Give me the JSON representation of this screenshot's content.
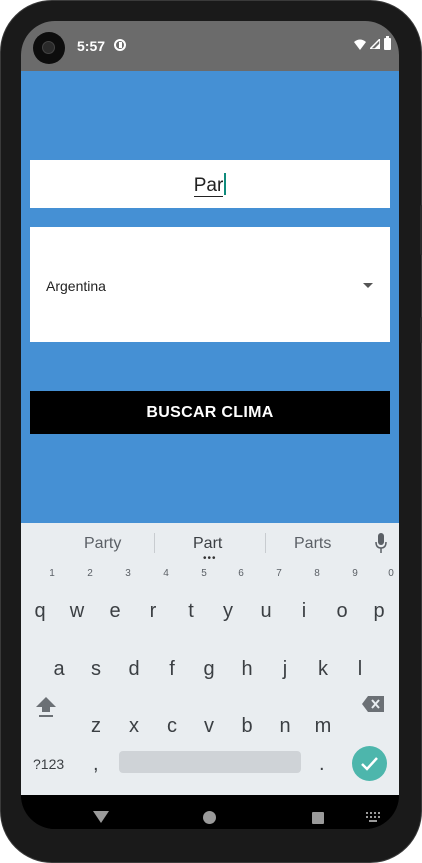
{
  "status_bar": {
    "time": "5:57",
    "icons": [
      "dnd-icon",
      "wifi-icon",
      "signal-icon",
      "battery-icon"
    ]
  },
  "app": {
    "background_color": "#4590d4",
    "city_input": {
      "value": "Par"
    },
    "country_select": {
      "selected": "Argentina"
    },
    "search_button": {
      "label": "BUSCAR CLIMA"
    }
  },
  "keyboard": {
    "suggestions": [
      "Party",
      "Part",
      "Parts"
    ],
    "row1": [
      "q",
      "w",
      "e",
      "r",
      "t",
      "y",
      "u",
      "i",
      "o",
      "p"
    ],
    "row1_hints": [
      "1",
      "2",
      "3",
      "4",
      "5",
      "6",
      "7",
      "8",
      "9",
      "0"
    ],
    "row2": [
      "a",
      "s",
      "d",
      "f",
      "g",
      "h",
      "j",
      "k",
      "l"
    ],
    "row3": [
      "z",
      "x",
      "c",
      "v",
      "b",
      "n",
      "m"
    ],
    "symbols_label": "?123",
    "comma": ",",
    "period": ".",
    "enter_color": "#4db6ac"
  }
}
